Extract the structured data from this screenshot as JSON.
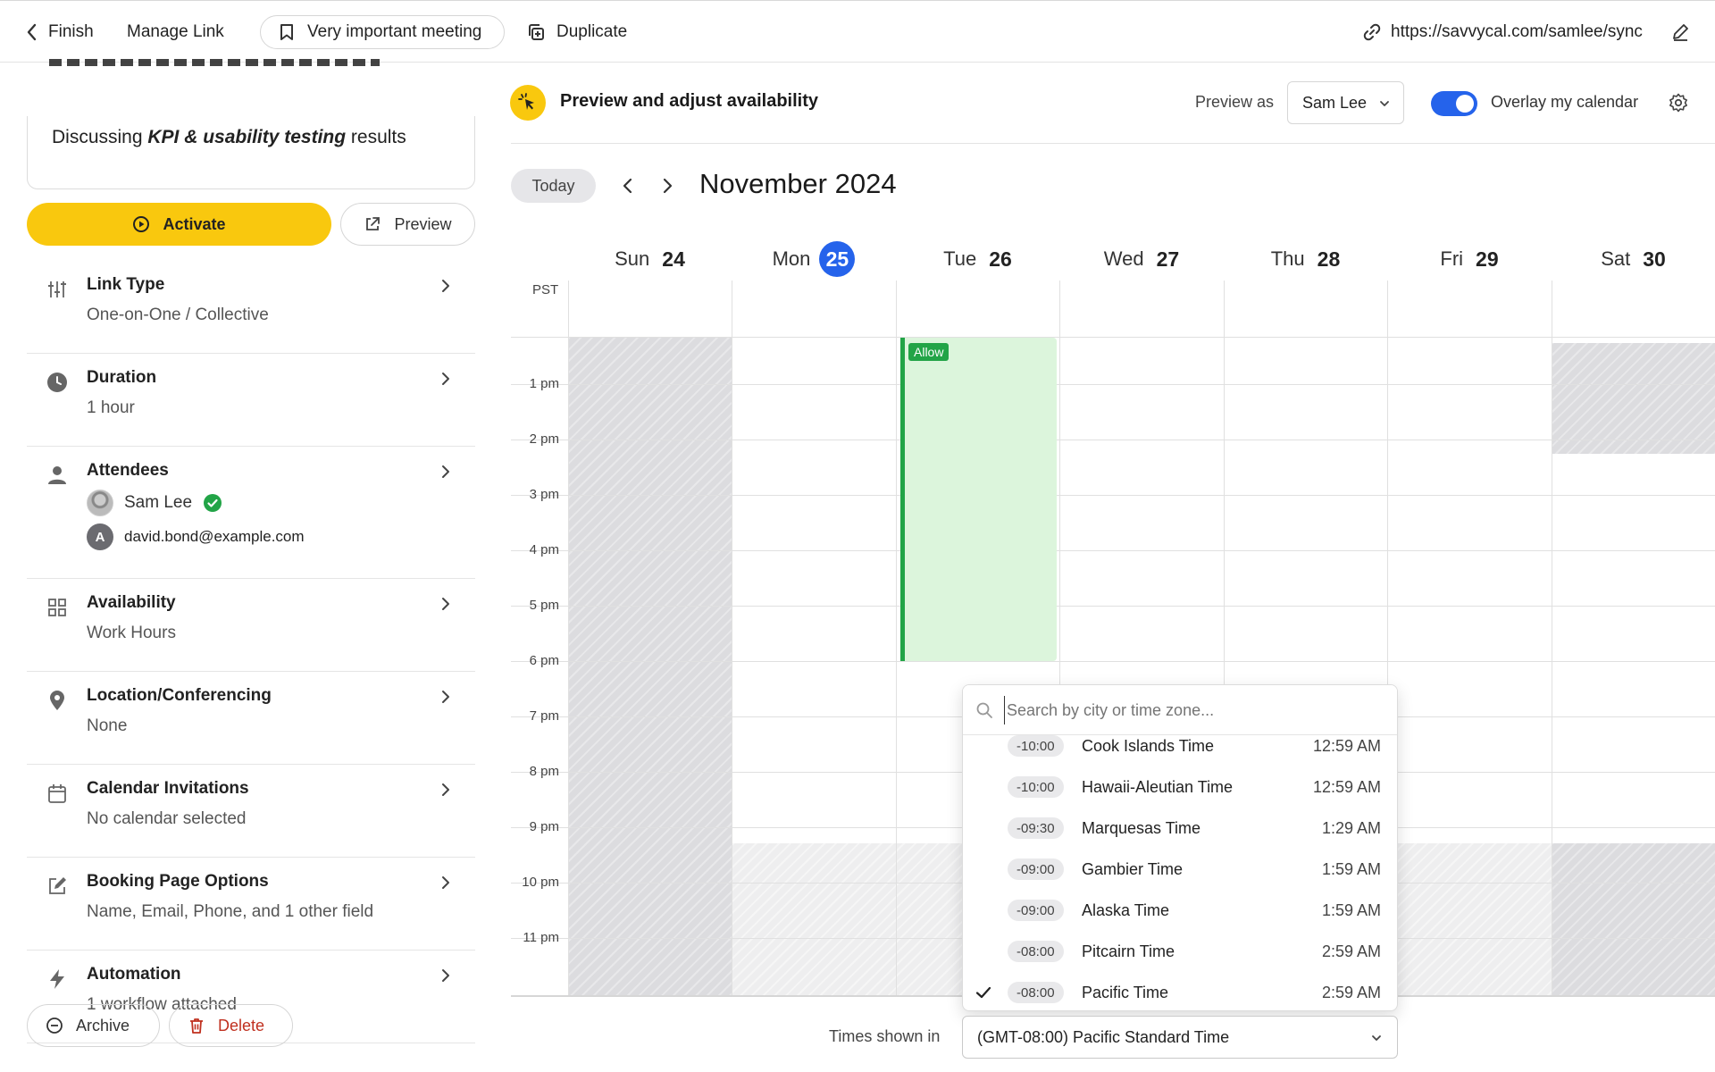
{
  "topbar": {
    "finish": "Finish",
    "manage_link": "Manage Link",
    "meeting": "Very important meeting",
    "duplicate": "Duplicate",
    "url": "https://savvycal.com/samlee/sync"
  },
  "sidebar": {
    "description_prefix": "Discussing ",
    "description_bold": "KPI & usability testing",
    "description_suffix": " results",
    "activate": "Activate",
    "preview": "Preview",
    "sections": [
      {
        "title": "Link Type",
        "sub": "One-on-One / Collective",
        "icon": "sliders-icon"
      },
      {
        "title": "Duration",
        "sub": "1 hour",
        "icon": "clock-icon"
      },
      {
        "title": "Attendees",
        "sub": "",
        "icon": "person-icon"
      },
      {
        "title": "Availability",
        "sub": "Work Hours",
        "icon": "grid-icon"
      },
      {
        "title": "Location/Conferencing",
        "sub": "None",
        "icon": "location-pin-icon"
      },
      {
        "title": "Calendar Invitations",
        "sub": "No calendar selected",
        "icon": "calendar-icon"
      },
      {
        "title": "Booking Page Options",
        "sub": "Name, Email, Phone, and 1 other field",
        "icon": "edit-icon"
      },
      {
        "title": "Automation",
        "sub": "1 workflow attached",
        "icon": "bolt-icon"
      }
    ],
    "attendees": [
      {
        "name": "Sam Lee",
        "avatar": ""
      },
      {
        "name": "david.bond@example.com",
        "avatar": "A"
      }
    ],
    "archive": "Archive",
    "delete": "Delete"
  },
  "header": {
    "title": "Preview and adjust availability",
    "preview_as_label": "Preview as",
    "preview_as_value": "Sam Lee",
    "overlay_label": "Overlay my calendar"
  },
  "calendar": {
    "today": "Today",
    "month": "November 2024",
    "tz_label": "PST",
    "days": [
      {
        "dow": "Sun",
        "num": "24"
      },
      {
        "dow": "Mon",
        "num": "25"
      },
      {
        "dow": "Tue",
        "num": "26"
      },
      {
        "dow": "Wed",
        "num": "27"
      },
      {
        "dow": "Thu",
        "num": "28"
      },
      {
        "dow": "Fri",
        "num": "29"
      },
      {
        "dow": "Sat",
        "num": "30"
      }
    ],
    "hours": [
      "1 pm",
      "2 pm",
      "3 pm",
      "4 pm",
      "5 pm",
      "6 pm",
      "7 pm",
      "8 pm",
      "9 pm",
      "10 pm",
      "11 pm"
    ],
    "allow_label": "Allow"
  },
  "timezone": {
    "search_placeholder": "Search by city or time zone...",
    "options": [
      {
        "offset": "-10:00",
        "name": "Cook Islands Time",
        "time": "12:59 AM",
        "selected": false
      },
      {
        "offset": "-10:00",
        "name": "Hawaii-Aleutian Time",
        "time": "12:59 AM",
        "selected": false
      },
      {
        "offset": "-09:30",
        "name": "Marquesas Time",
        "time": "1:29 AM",
        "selected": false
      },
      {
        "offset": "-09:00",
        "name": "Gambier Time",
        "time": "1:59 AM",
        "selected": false
      },
      {
        "offset": "-09:00",
        "name": "Alaska Time",
        "time": "1:59 AM",
        "selected": false
      },
      {
        "offset": "-08:00",
        "name": "Pitcairn Time",
        "time": "2:59 AM",
        "selected": false
      },
      {
        "offset": "-08:00",
        "name": "Pacific Time",
        "time": "2:59 AM",
        "selected": true
      }
    ],
    "shown_in_label": "Times shown in",
    "current": "(GMT-08:00) Pacific Standard Time"
  },
  "colors": {
    "accent_yellow": "#f9c80e",
    "accent_blue": "#2563eb",
    "allow_green": "#22a447",
    "allow_fill": "#dcf5dc"
  }
}
